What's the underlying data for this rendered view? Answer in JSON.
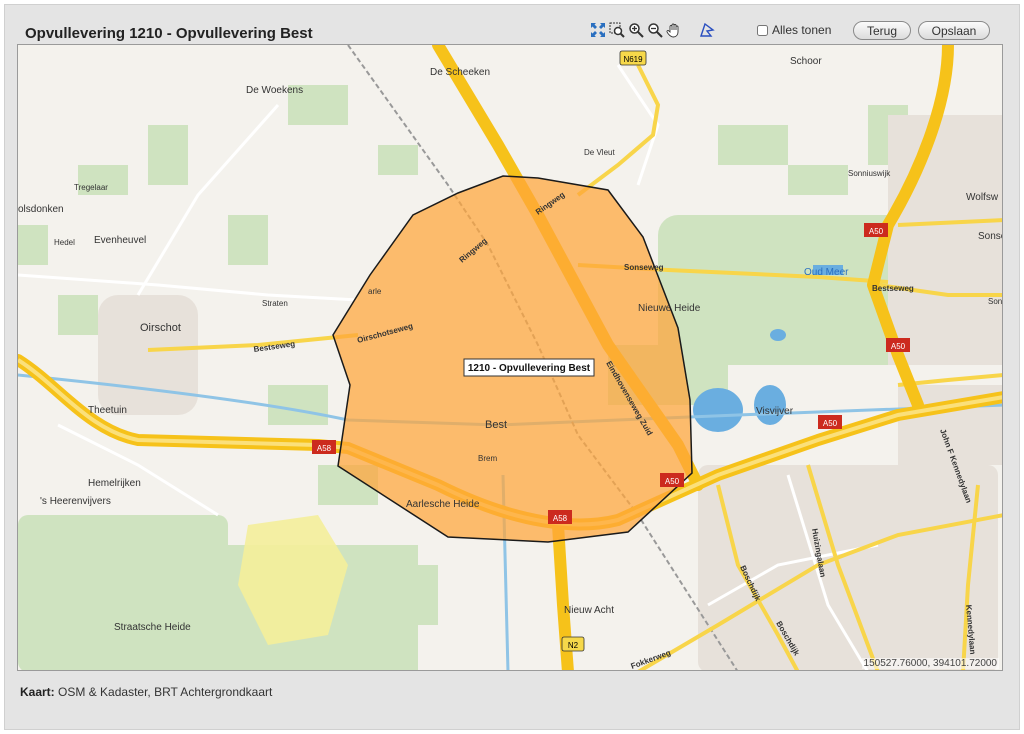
{
  "header": {
    "title": "Opvullevering 1210 - Opvullevering Best"
  },
  "toolbar": {
    "tools": [
      {
        "name": "zoom-extent-icon"
      },
      {
        "name": "zoom-box-icon"
      },
      {
        "name": "zoom-in-icon"
      },
      {
        "name": "zoom-out-icon"
      },
      {
        "name": "pan-hand-icon"
      },
      {
        "name": "draw-polygon-icon"
      }
    ],
    "show_all_label": "Alles tonen",
    "back_label": "Terug",
    "save_label": "Opslaan"
  },
  "map": {
    "polygon_label": "1210 - Opvullevering Best",
    "coordinates": "150527.76000, 394101.72000",
    "place_labels": [
      "De Scheeken",
      "Schoor",
      "De Woekens",
      "De Vleut",
      "Sonniuswijk",
      "Tregelaar",
      "olsdonken",
      "Wolfsw",
      "Hedel",
      "Evenheuvel",
      "Sonse",
      "Oud Meer",
      "Straten",
      "Bestseweg",
      "Oirschot",
      "Nieuwe Heide",
      "Bestseweg",
      "Oirschotseweg",
      "Ringweg",
      "Ringweg",
      "Sonseweg",
      "arle",
      "Theetuin",
      "Eindhovenseweg Zuid",
      "Visvijver",
      "Best",
      "Brem",
      "John F Kennedylaan",
      "Hemelrijken",
      "'s Heerenvijvers",
      "Aarlesche Heide",
      "Straatsche Heide",
      "Nieuw Acht",
      "Huizingalaan",
      "Boschdijk",
      "Boschdijk",
      "Fokkerweg",
      "Kennedylaan",
      "Sons"
    ],
    "shields": [
      "N619",
      "A50",
      "A50",
      "A50",
      "A50",
      "A58",
      "A58",
      "N2"
    ],
    "colors": {
      "polygon_fill": "#ffa53a",
      "motorway": "#f6c21a",
      "forest": "#cfe3c0",
      "field": "#f5f3ee",
      "water": "#6aaee0",
      "shield": "#cc2a1e"
    }
  },
  "footer": {
    "source_label": "Kaart:",
    "source_text": "OSM & Kadaster, BRT Achtergrondkaart"
  }
}
